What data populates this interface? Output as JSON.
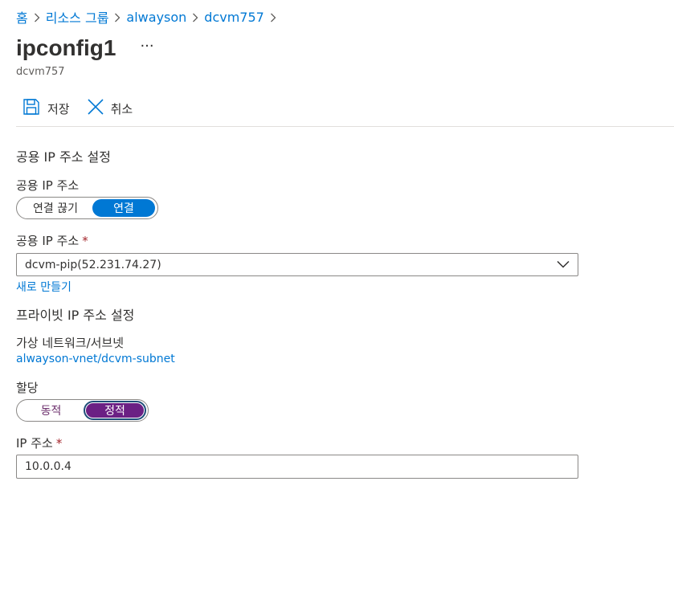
{
  "breadcrumb": {
    "items": [
      "홈",
      "리소스 그룹",
      "alwayson",
      "dcvm757"
    ]
  },
  "header": {
    "title": "ipconfig1",
    "more": "···",
    "subtitle": "dcvm757"
  },
  "toolbar": {
    "save_label": "저장",
    "cancel_label": "취소"
  },
  "public_ip": {
    "section_title": "공용 IP 주소 설정",
    "toggle_label": "공용 IP 주소",
    "toggle_options": [
      "연결 끊기",
      "연결"
    ],
    "toggle_selected": "연결",
    "address_label": "공용 IP 주소",
    "required_mark": "*",
    "address_value": "dcvm-pip(52.231.74.27)",
    "create_new": "새로 만들기"
  },
  "private_ip": {
    "section_title": "프라이빗 IP 주소 설정",
    "vnet_label": "가상 네트워크/서브넷",
    "vnet_value": "alwayson-vnet/dcvm-subnet",
    "assignment_label": "할당",
    "assignment_options": [
      "동적",
      "정적"
    ],
    "assignment_selected": "정적",
    "ip_label": "IP 주소",
    "required_mark": "*",
    "ip_value": "10.0.0.4"
  },
  "colors": {
    "link": "#0078d4",
    "toggle_on_public": "#0078d4",
    "toggle_on_private": "#6b2084",
    "required": "#a4262c"
  }
}
